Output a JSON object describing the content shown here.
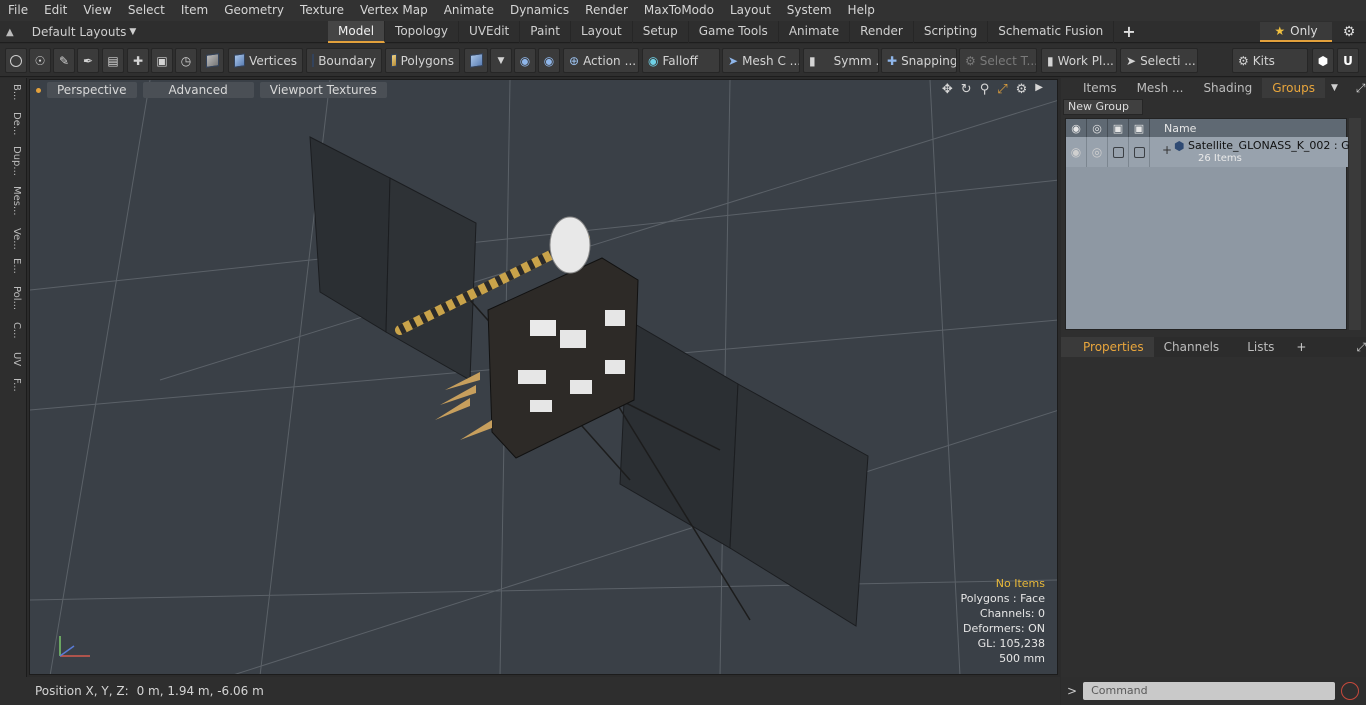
{
  "menu": [
    "File",
    "Edit",
    "View",
    "Select",
    "Item",
    "Geometry",
    "Texture",
    "Vertex Map",
    "Animate",
    "Dynamics",
    "Render",
    "MaxToModo",
    "Layout",
    "System",
    "Help"
  ],
  "layouts": {
    "label": "Default Layouts"
  },
  "tabs": [
    "Model",
    "Topology",
    "UVEdit",
    "Paint",
    "Layout",
    "Setup",
    "Game Tools",
    "Animate",
    "Render",
    "Scripting",
    "Schematic Fusion"
  ],
  "only_label": "Only",
  "toolbar": {
    "vertices": "Vertices",
    "boundary": "Boundary",
    "polygons": "Polygons",
    "action": "Action",
    "falloff": "Falloff",
    "mesh": "Mesh C ...",
    "symm": "Symm ...",
    "snapping": "Snapping",
    "select_t": "Select T...",
    "workplane": "Work Pl...",
    "selection": "Selecti ...",
    "kits": "Kits"
  },
  "left_strip": [
    "B...",
    "De...",
    "Dup...",
    "Mes...",
    "Ve...",
    "E...",
    "Pol...",
    "C...",
    "UV",
    "F..."
  ],
  "viewport": {
    "perspective": "Perspective",
    "advanced": "Advanced",
    "textures": "Viewport Textures",
    "info": {
      "items": "No Items",
      "polygons": "Polygons : Face",
      "channels": "Channels: 0",
      "deformers": "Deformers: ON",
      "gl": "GL: 105,238",
      "scale": "500 mm"
    }
  },
  "status": {
    "label": "Position X, Y, Z:",
    "value": "0 m, 1.94 m, -6.06 m"
  },
  "right_tabs": [
    "Items",
    "Mesh ...",
    "Shading",
    "Groups"
  ],
  "new_group": "New Group",
  "groups_header": {
    "name": "Name"
  },
  "group_item": {
    "name": "Satellite_GLONASS_K_002 : G...",
    "count": "26 Items"
  },
  "props_tabs": [
    "Properties",
    "Channels",
    "Lists"
  ],
  "command": {
    "placeholder": "Command"
  },
  "colors": {
    "accent": "#e3a13c",
    "viewport_bg": "#3a4047",
    "panel_list": "#8e98a3"
  }
}
